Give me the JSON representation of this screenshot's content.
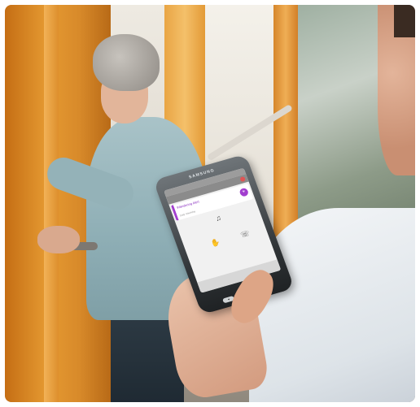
{
  "phone": {
    "brand": "SAMSUNG",
    "app": {
      "alert": {
        "title": "Wandering Alert",
        "subtitle": "Daily Weekday",
        "action_icon": "add-icon"
      },
      "icons": [
        "bell-icon",
        "phone-icon",
        "hand-icon"
      ]
    }
  },
  "colors": {
    "accent": "#a23ecf",
    "door": "#e59a32",
    "uniform": "#f4f6f8"
  }
}
